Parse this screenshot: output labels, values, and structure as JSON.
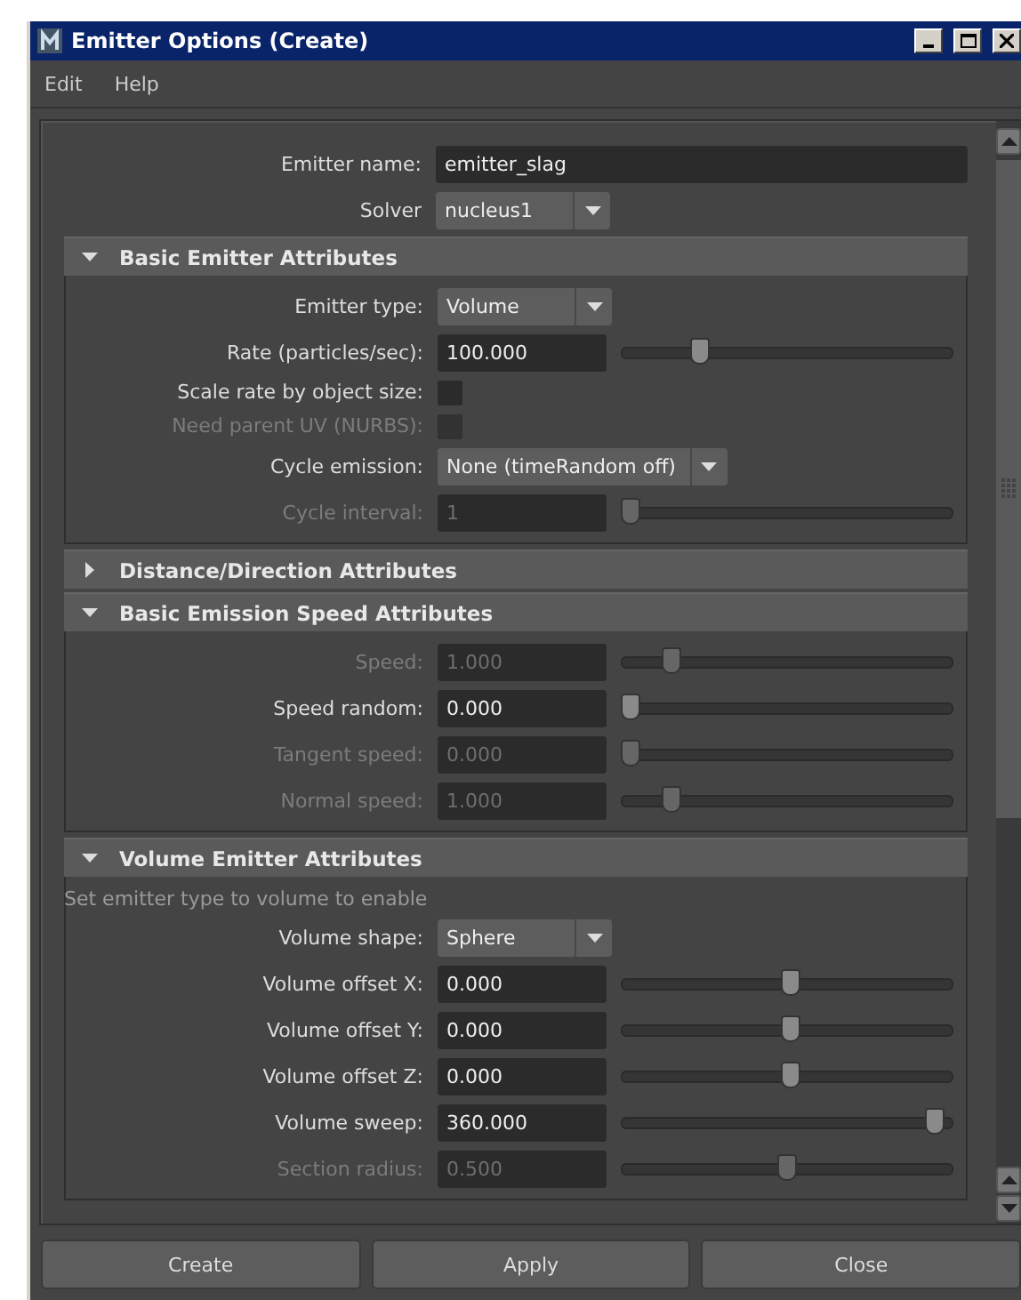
{
  "window": {
    "title": "Emitter Options (Create)"
  },
  "menu": [
    "Edit",
    "Help"
  ],
  "top_fields": [
    {
      "kind": "text",
      "label": "Emitter name:",
      "value": "emitter_slag"
    },
    {
      "kind": "dropdown",
      "label": "Solver",
      "value": "nucleus1"
    }
  ],
  "sections": [
    {
      "title": "Basic Emitter Attributes",
      "expanded": true,
      "rows": [
        {
          "kind": "dropdown",
          "label": "Emitter type:",
          "value": "Volume",
          "disabled": false
        },
        {
          "kind": "slider",
          "label": "Rate (particles/sec):",
          "value": "100.000",
          "level": 0.22,
          "disabled": false
        },
        {
          "kind": "checkbox",
          "label": "Scale rate by object size:",
          "checked": false,
          "disabled": false
        },
        {
          "kind": "checkbox",
          "label": "Need parent UV (NURBS):",
          "checked": false,
          "disabled": true
        },
        {
          "kind": "dropdown",
          "label": "Cycle emission:",
          "value": "None (timeRandom off)",
          "disabled": false
        },
        {
          "kind": "slider",
          "label": "Cycle interval:",
          "value": "1",
          "level": 0,
          "disabled": true
        }
      ]
    },
    {
      "title": "Distance/Direction Attributes",
      "expanded": false
    },
    {
      "title": "Basic Emission Speed Attributes",
      "expanded": true,
      "rows": [
        {
          "kind": "slider",
          "label": "Speed:",
          "value": "1.000",
          "level": 0.13,
          "disabled": true
        },
        {
          "kind": "slider",
          "label": "Speed random:",
          "value": "0.000",
          "level": 0,
          "disabled": false
        },
        {
          "kind": "slider",
          "label": "Tangent speed:",
          "value": "0.000",
          "level": 0,
          "disabled": true
        },
        {
          "kind": "slider",
          "label": "Normal speed:",
          "value": "1.000",
          "level": 0.13,
          "disabled": true
        }
      ]
    },
    {
      "title": "Volume Emitter Attributes",
      "expanded": true,
      "note": "Set emitter type to volume to enable",
      "rows": [
        {
          "kind": "dropdown",
          "label": "Volume shape:",
          "value": "Sphere",
          "disabled": false
        },
        {
          "kind": "slider",
          "label": "Volume offset X:",
          "value": "0.000",
          "level": 0.51,
          "disabled": false
        },
        {
          "kind": "slider",
          "label": "Volume offset Y:",
          "value": "0.000",
          "level": 0.51,
          "disabled": false
        },
        {
          "kind": "slider",
          "label": "Volume offset Z:",
          "value": "0.000",
          "level": 0.51,
          "disabled": false
        },
        {
          "kind": "slider",
          "label": "Volume sweep:",
          "value": "360.000",
          "level": 0.97,
          "disabled": false
        },
        {
          "kind": "slider",
          "label": "Section radius:",
          "value": "0.500",
          "level": 0.5,
          "disabled": true
        }
      ]
    }
  ],
  "buttons": [
    "Create",
    "Apply",
    "Close"
  ]
}
